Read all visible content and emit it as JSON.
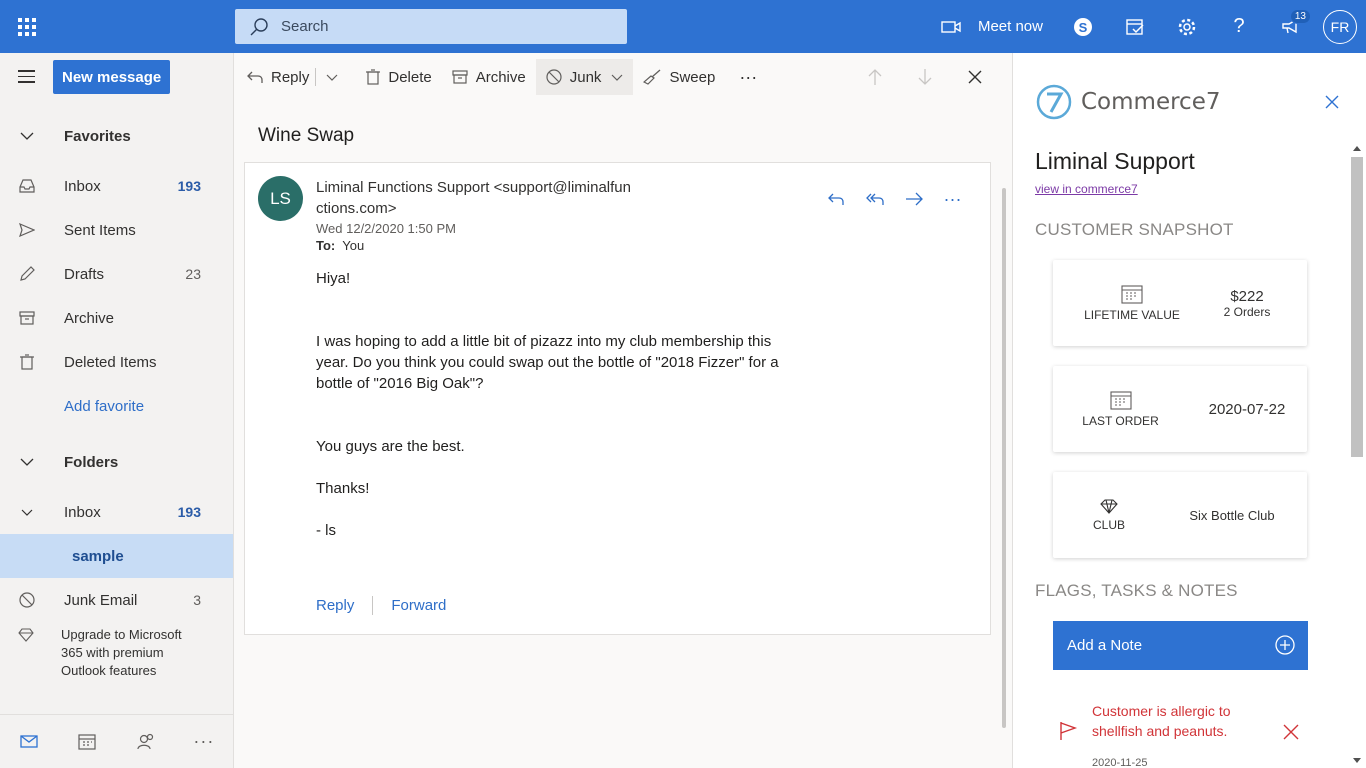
{
  "topbar": {
    "search_placeholder": "Search",
    "meet_now_label": "Meet now",
    "notification_count": "13",
    "user_initials": "FR"
  },
  "leftnav": {
    "new_message_label": "New message",
    "favorites_label": "Favorites",
    "favorites": [
      {
        "label": "Inbox",
        "count": "193",
        "icon": "inbox-icon"
      },
      {
        "label": "Sent Items",
        "count": "",
        "icon": "send-icon"
      },
      {
        "label": "Drafts",
        "count": "23",
        "icon": "pencil-icon"
      },
      {
        "label": "Archive",
        "count": "",
        "icon": "archive-icon"
      },
      {
        "label": "Deleted Items",
        "count": "",
        "icon": "trash-icon"
      }
    ],
    "add_favorite_label": "Add favorite",
    "folders_label": "Folders",
    "folder_inbox_label": "Inbox",
    "folder_inbox_count": "193",
    "folder_sample_label": "sample",
    "junk_label": "Junk Email",
    "junk_count": "3",
    "upgrade_text": "Upgrade to Microsoft 365 with premium Outlook features"
  },
  "toolbar": {
    "reply": "Reply",
    "delete": "Delete",
    "archive": "Archive",
    "junk": "Junk",
    "sweep": "Sweep",
    "more": "···"
  },
  "message": {
    "subject": "Wine Swap",
    "avatar_initials": "LS",
    "sender_line1": "Liminal Functions Support <support@liminalfun",
    "sender_line2": "ctions.com>",
    "date": "Wed 12/2/2020 1:50 PM",
    "to_label": "To:",
    "to_value": "You",
    "body": {
      "p1": "Hiya!",
      "p2_line1": "I was hoping to add a little bit of pizazz into my club membership this",
      "p2_line2": "year. Do you think you could swap out the bottle of \"2018 Fizzer\" for a",
      "p2_line3": "bottle of \"2016 Big Oak\"?",
      "p3": "You guys are the best.",
      "p4": "Thanks!",
      "p5": "- ls"
    },
    "reply_label": "Reply",
    "forward_label": "Forward",
    "more_actions": "···"
  },
  "panel": {
    "brand": "Commerce7",
    "customer_name": "Liminal Support",
    "customer_link": "view in commerce7",
    "snapshot_title": "CUSTOMER SNAPSHOT",
    "lifetime_label": "LIFETIME VALUE",
    "lifetime_value": "$222",
    "lifetime_orders": "2 Orders",
    "last_order_label": "LAST ORDER",
    "last_order_value": "2020-07-22",
    "club_label": "CLUB",
    "club_value": "Six Bottle Club",
    "flags_title": "FLAGS, TASKS & NOTES",
    "add_note_label": "Add a Note",
    "flag_text": "Customer is allergic to shellfish and peanuts.",
    "flag_date": "2020-11-25"
  },
  "colors": {
    "brand_blue": "#2e72d2",
    "selected_bg": "#c7dcf5",
    "flag_red": "#d13438",
    "avatar_teal": "#2a6e68"
  }
}
